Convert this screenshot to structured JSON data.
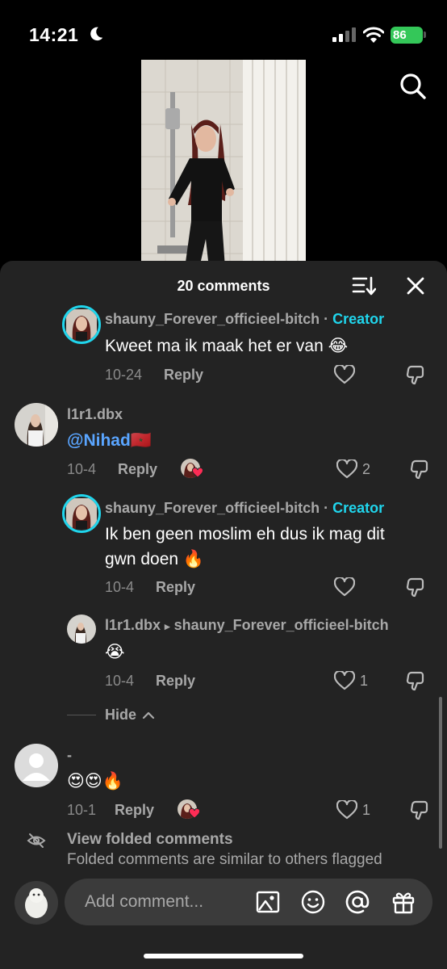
{
  "status_bar": {
    "time": "14:21",
    "battery": "86"
  },
  "sheet": {
    "title": "20 comments"
  },
  "comments": [
    {
      "username": "shauny_Forever_officieel-bitch",
      "separator": "·",
      "badge": "Creator",
      "text": "Kweet ma ik maak het er van",
      "emoji": "😂",
      "date": "10-24",
      "reply": "Reply"
    },
    {
      "username": "l1r1.dbx",
      "text": "@Nihad",
      "emoji": "🇲🇦",
      "date": "10-4",
      "reply": "Reply",
      "likes": "2"
    },
    {
      "username": "shauny_Forever_officieel-bitch",
      "separator": "·",
      "badge": "Creator",
      "text_line1": "Ik ben geen moslim eh dus ik mag dit",
      "text_line2": "gwn doen",
      "emoji": "🔥",
      "date": "10-4",
      "reply": "Reply"
    },
    {
      "username": "l1r1.dbx",
      "reply_arrow": "▸",
      "reply_to": "shauny_Forever_officieel-bitch",
      "emoji": "😭",
      "date": "10-4",
      "reply": "Reply",
      "likes": "1"
    },
    {
      "username": "-",
      "emoji": "😍😍🔥",
      "date": "10-1",
      "reply": "Reply",
      "likes": "1"
    }
  ],
  "hide_label": "Hide",
  "folded": {
    "title": "View folded comments",
    "subtitle": "Folded comments are similar to others flagged"
  },
  "input": {
    "placeholder": "Add comment..."
  },
  "colors": {
    "creator": "#20d5ec",
    "mention": "#5aa5ff",
    "sheet_bg": "#232323",
    "battery": "#34c759"
  },
  "icons": [
    "moon-icon",
    "signal-icon",
    "wifi-icon",
    "battery-icon",
    "search-icon",
    "sort-icon",
    "close-icon",
    "heart-icon",
    "dislike-icon",
    "chevron-up-icon",
    "eye-off-icon",
    "image-icon",
    "emoji-icon",
    "at-icon",
    "gift-icon"
  ]
}
